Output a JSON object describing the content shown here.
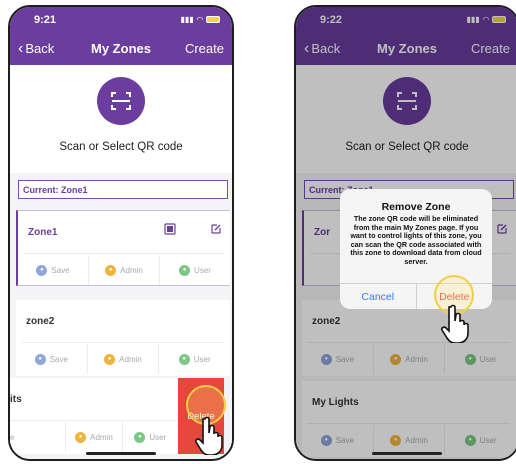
{
  "left": {
    "status": {
      "time": "9:21"
    },
    "nav": {
      "back": "Back",
      "title": "My Zones",
      "create": "Create"
    },
    "qr_label": "Scan or Select QR code",
    "current": "Current:  Zone1",
    "zones": [
      {
        "name": "Zone1"
      },
      {
        "name": "zone2"
      },
      {
        "name": "its"
      }
    ],
    "roles": {
      "save": "Save",
      "admin": "Admin",
      "user": "User"
    },
    "partial_save": "e",
    "swipe_delete": "Delete"
  },
  "right": {
    "status": {
      "time": "9:22"
    },
    "nav": {
      "back": "Back",
      "title": "My Zones",
      "create": "Create"
    },
    "qr_label": "Scan or Select QR code",
    "current": "Current:  Zone1",
    "zones": [
      {
        "name": "Zor"
      },
      {
        "name": "zone2"
      },
      {
        "name": "My Lights"
      }
    ],
    "roles": {
      "save": "Save",
      "admin": "Admin",
      "user": "User"
    },
    "alert": {
      "title": "Remove Zone",
      "message": "The zone QR code will be eliminated from the main My Zones page. If you want to control lights of this zone, you can scan the QR code associated with this zone to download data from cloud server.",
      "cancel": "Cancel",
      "delete": "Delete"
    }
  },
  "colors": {
    "brand": "#6a3d9e",
    "delete": "#e5483b",
    "ring": "#f3cf45",
    "save": "#8fa6d9",
    "admin": "#f0b43c",
    "user": "#7cc785"
  },
  "icons": [
    "qr-scan-icon",
    "chevron-left-icon",
    "document-icon",
    "edit-icon",
    "hand-pointer-icon",
    "wifi-icon",
    "signal-icon",
    "battery-icon"
  ]
}
